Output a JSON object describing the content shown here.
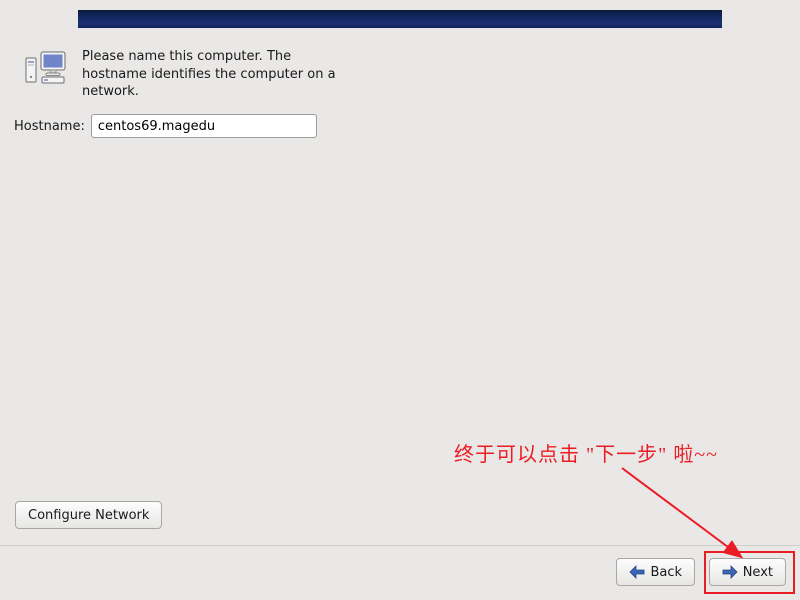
{
  "instruction": "Please name this computer.  The hostname identifies the computer on a network.",
  "hostname": {
    "label": "Hostname:",
    "value": "centos69.magedu"
  },
  "buttons": {
    "configure_network": "Configure Network",
    "back": "Back",
    "next": "Next"
  },
  "annotation": {
    "text": "终于可以点击 \"下一步\" 啦~~"
  },
  "colors": {
    "annotation_red": "#ec1c24",
    "topbar_blue": "#142862"
  }
}
